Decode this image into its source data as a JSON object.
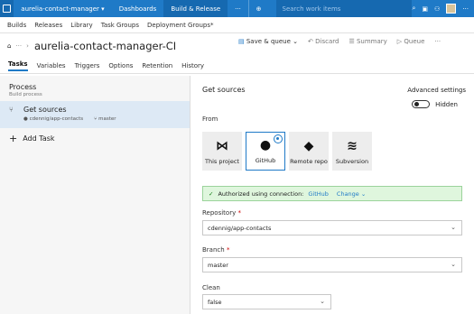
{
  "topnav": {
    "project": "aurelia-contact-manager",
    "items": [
      "Dashboards",
      "Build & Release"
    ],
    "more": "···",
    "search_placeholder": "Search work items",
    "trailing_more": "···"
  },
  "subnav": {
    "items": [
      "Builds",
      "Releases",
      "Library",
      "Task Groups",
      "Deployment Groups*"
    ]
  },
  "header": {
    "title": "aurelia-contact-manager-CI",
    "ellipsis": "···",
    "save_queue": "Save & queue",
    "discard": "Discard",
    "summary": "Summary",
    "queue": "Queue",
    "more": "···"
  },
  "tabs": [
    "Tasks",
    "Variables",
    "Triggers",
    "Options",
    "Retention",
    "History"
  ],
  "left": {
    "process_title": "Process",
    "process_sub": "Build process",
    "task_title": "Get sources",
    "task_repo": "cdennig/app-contacts",
    "task_branch": "master",
    "add_task": "Add Task"
  },
  "right": {
    "title": "Get sources",
    "advanced": "Advanced settings",
    "hidden": "Hidden",
    "from_label": "From",
    "tiles": [
      {
        "label": "This project",
        "icon": "visual-studio-icon",
        "glyph": "⋈"
      },
      {
        "label": "GitHub",
        "icon": "github-icon",
        "glyph": "●"
      },
      {
        "label": "Remote repo",
        "icon": "git-icon",
        "glyph": "◆"
      },
      {
        "label": "Subversion",
        "icon": "subversion-icon",
        "glyph": "≋"
      }
    ],
    "auth_text": "Authorized using connection:",
    "auth_conn": "GitHub",
    "change": "Change",
    "repository_label": "Repository",
    "repository_value": "cdennig/app-contacts",
    "branch_label": "Branch",
    "branch_value": "master",
    "clean_label": "Clean",
    "clean_value": "false"
  }
}
